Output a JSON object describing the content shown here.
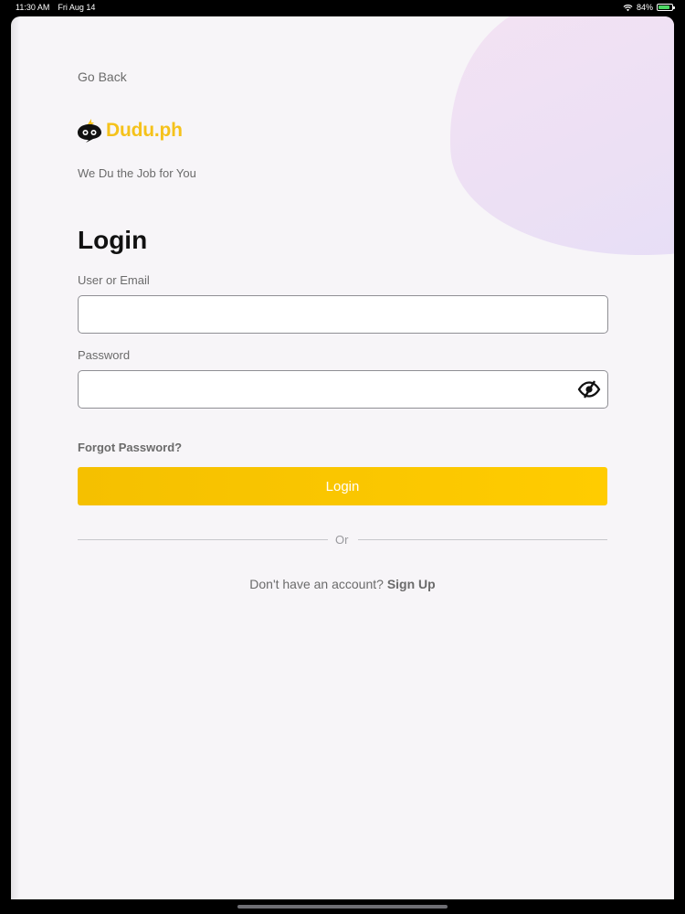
{
  "status_bar": {
    "time": "11:30 AM",
    "date": "Fri Aug 14",
    "battery_percent": "84%",
    "battery_level": 0.84
  },
  "nav": {
    "go_back_label": "Go Back"
  },
  "brand": {
    "name": "Dudu.ph",
    "tagline": "We Du the Job for You",
    "accent_color": "#f5c21b"
  },
  "login": {
    "title": "Login",
    "user_label": "User or Email",
    "user_value": "",
    "password_label": "Password",
    "password_value": "",
    "forgot_password": "Forgot Password?",
    "submit_label": "Login",
    "button_color": "#ffc800",
    "divider_text": "Or",
    "signup_prompt": "Don't have an account? ",
    "signup_link": "Sign Up"
  },
  "icons": {
    "wifi": "wifi-icon",
    "battery": "battery-icon",
    "logo": "robot-chat-icon",
    "toggle_password": "eye-slash-icon"
  }
}
